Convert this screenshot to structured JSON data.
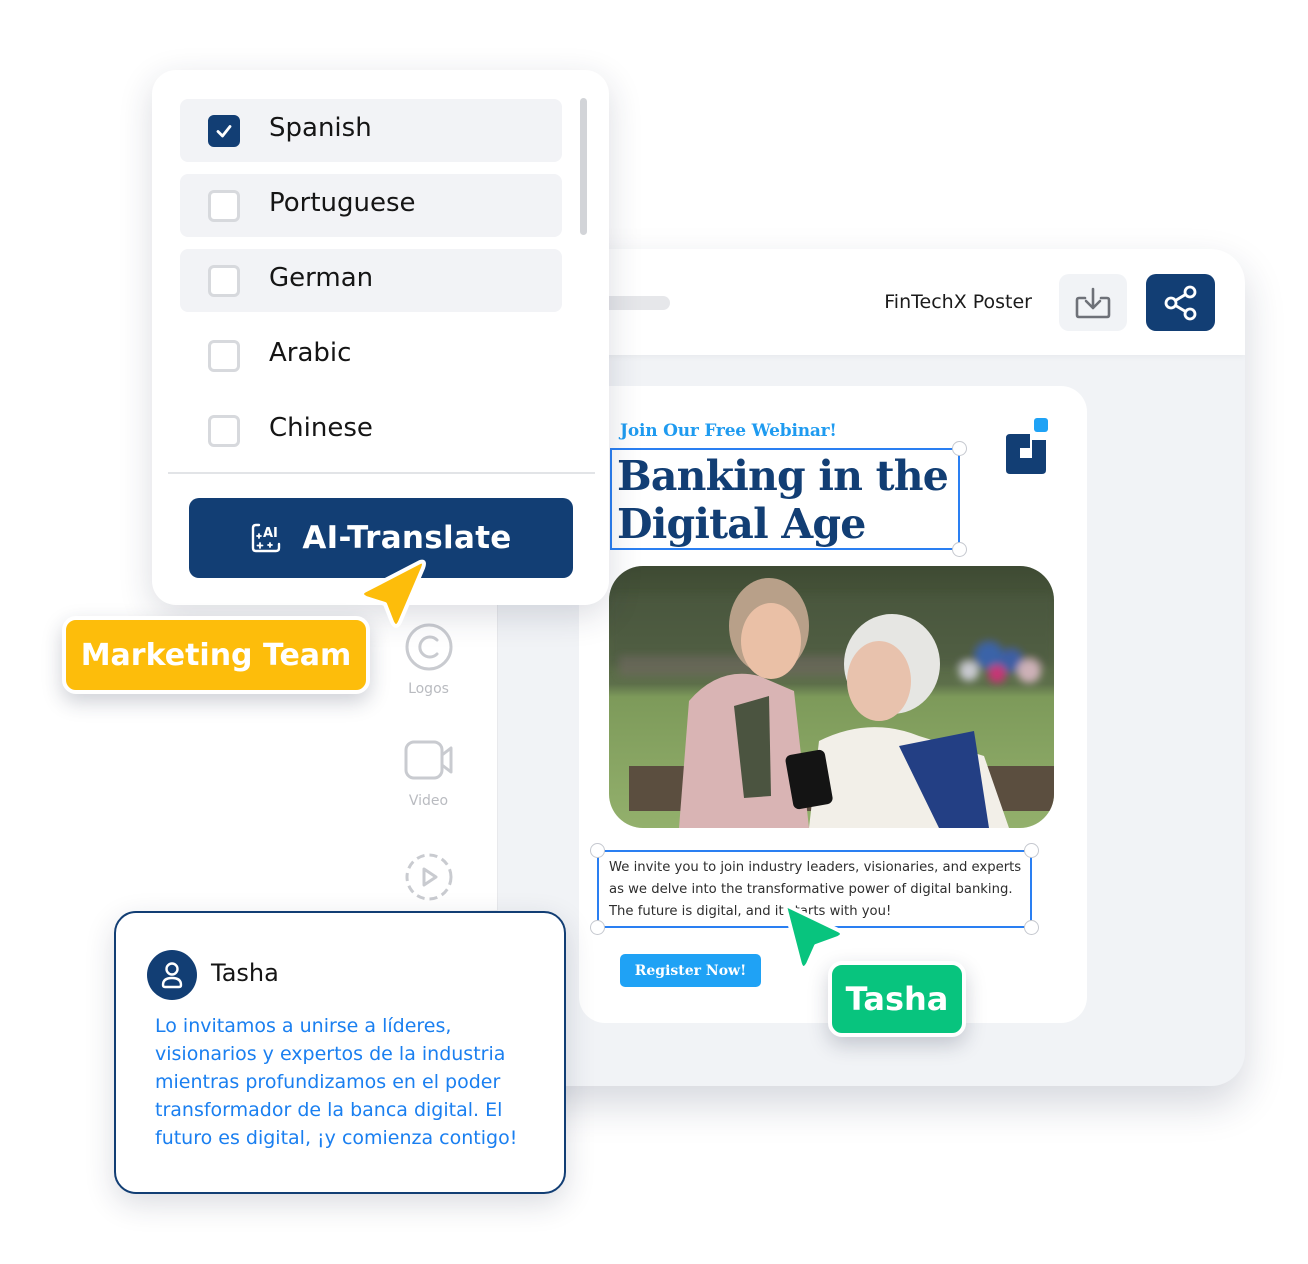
{
  "editor": {
    "document_title": "FinTechX Poster",
    "download_icon": "download-icon",
    "share_icon": "share-icon",
    "tools": [
      {
        "label": "Logos",
        "icon": "copyright-icon"
      },
      {
        "label": "Video",
        "icon": "video-camera-icon"
      },
      {
        "label": "",
        "icon": "animation-play-icon"
      }
    ]
  },
  "poster": {
    "kicker": "Join Our Free Webinar!",
    "headline_line1": "Banking in the",
    "headline_line2": "Digital Age",
    "brand_logo": "brand-logo-icon",
    "photo_alt": "Young woman showing phone to elderly woman on park bench",
    "body": "We invite you to join industry leaders, visionaries, and experts as we delve into the transformative power of digital banking. The future is digital, and it starts with you!",
    "cta_label": "Register Now!",
    "colors": {
      "primary": "#123e74",
      "accent": "#1fa2f5",
      "selection": "#2a7ff2"
    }
  },
  "language_menu": {
    "options": [
      {
        "label": "Spanish",
        "checked": true
      },
      {
        "label": "Portuguese",
        "checked": false
      },
      {
        "label": "German",
        "checked": false
      },
      {
        "label": "Arabic",
        "checked": false
      },
      {
        "label": "Chinese",
        "checked": false
      }
    ],
    "translate_button": "AI-Translate",
    "translate_icon": "ai-sparkle-icon"
  },
  "collaborators": [
    {
      "name": "Marketing Team",
      "color": "#fdbd0b"
    },
    {
      "name": "Tasha",
      "color": "#08c47e"
    }
  ],
  "comment": {
    "author": "Tasha",
    "text": "Lo invitamos a unirse a líderes, visionarios y expertos de la industria mientras profundizamos en el poder transformador de la banca digital. El futuro es digital, ¡y comienza contigo!"
  }
}
